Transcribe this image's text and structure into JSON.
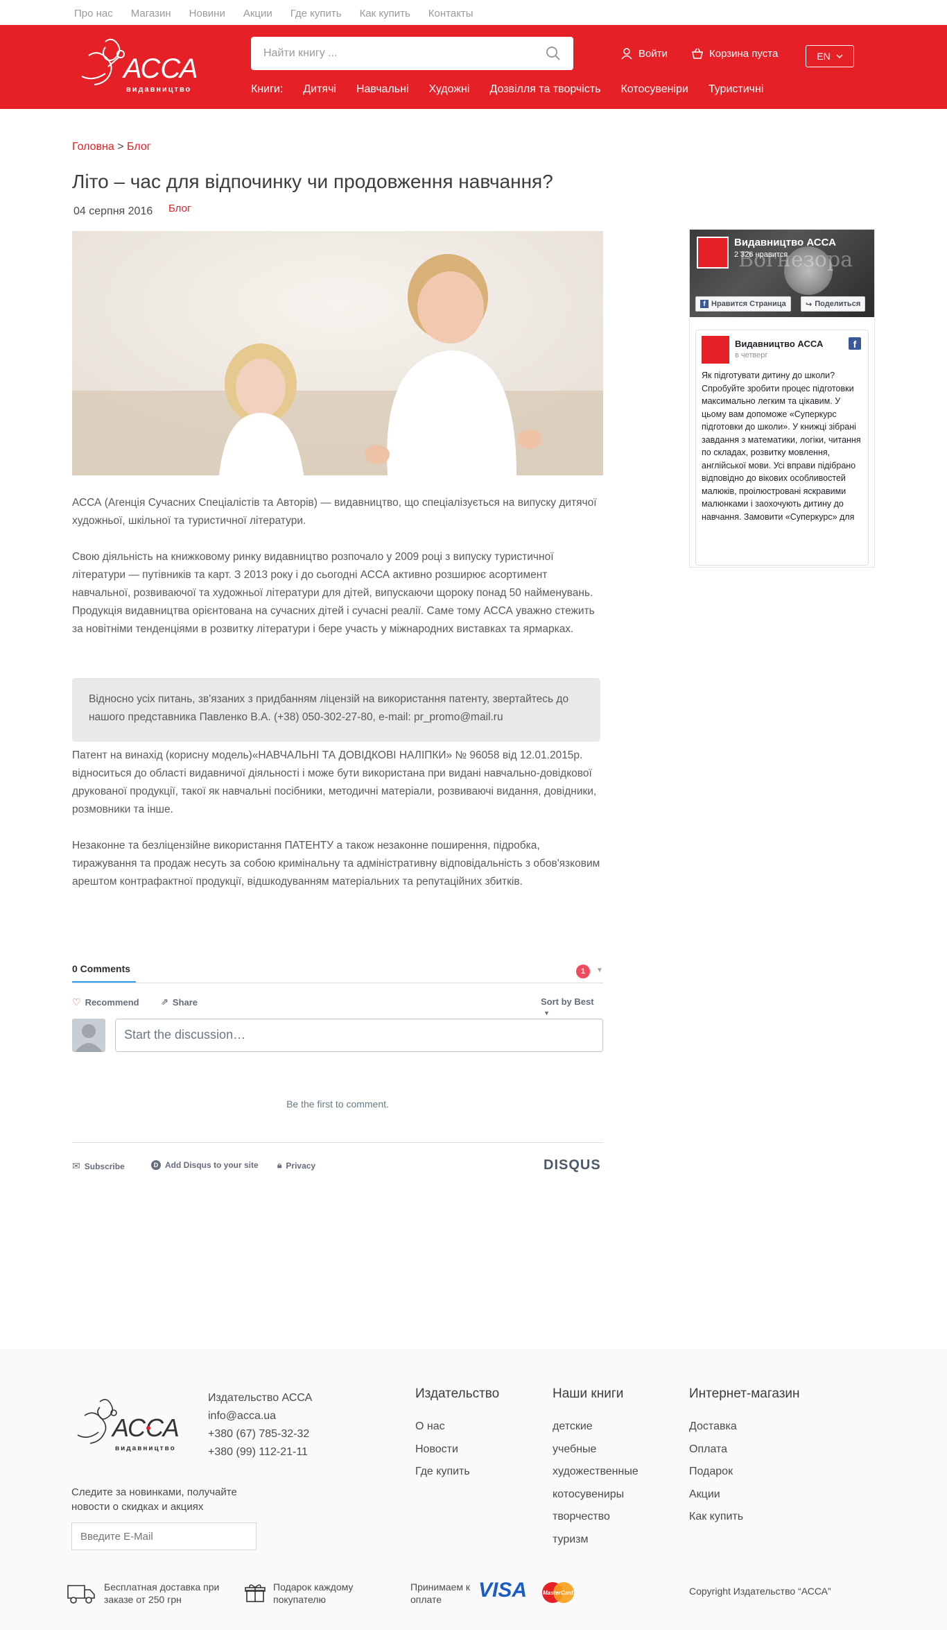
{
  "topnav": [
    "Про нас",
    "Магазин",
    "Новини",
    "Акции",
    "Где купить",
    "Как купить",
    "Контакты"
  ],
  "header": {
    "logo_text": "АССА",
    "logo_sub": "видавництво",
    "search_placeholder": "Найти книгу ...",
    "login": "Войти",
    "cart": "Корзина пуста",
    "lang": "EN"
  },
  "categories": [
    "Книги:",
    "Дитячі",
    "Навчальні",
    "Художні",
    "Дозвілля та творчість",
    "Котосувеніри",
    "Туристичні"
  ],
  "breadcrumb": {
    "home": "Головна",
    "sep": ">",
    "current": "Блог"
  },
  "article": {
    "title": "Літо – час для відпочинку чи продовження навчання?",
    "date": "04 серпня 2016",
    "category": "Блог",
    "p1": "АССА (Агенція Сучасних Спеціалістів та Авторів) — видавництво, що спеціалізується на випуску дитячої художньої, шкільної та туристичної літератури.",
    "p2": "Свою діяльність на книжковому ринку видавництво розпочало у 2009 році з випуску туристичної літератури — путівників та карт. З 2013 року і до сьогодні АССА активно розширює асортимент навчальної, розвиваючої та художньої літератури для дітей, випускаючи щороку понад 50 найменувань. Продукція видавництва орієнтована на сучасних дітей і сучасні реалії. Саме тому АССА уважно стежить за новітніми тенденціями в розвитку літератури і бере участь у міжнародних виставках та ярмарках.",
    "notice": "Відносно усіх питань, зв'язаних з придбанням ліцензій на використання патенту, звертайтесь до нашого представника Павленко В.А. (+38) 050-302-27-80, e-mail: pr_promo@mail.ru",
    "p3": "Патент на винахід (корисну модель)«НАВЧАЛЬНІ ТА ДОВІДКОВІ НАЛІПКИ» № 96058 від 12.01.2015р. відноситься до області видавничої діяльності і може бути використана при видані навчально-довідкової друкованої продукції, такої як навчальні посібники, методичні матеріали, розвиваючі видання, довідники, розмовники та інше.",
    "p4": "Незаконне та безліцензійне використання ПАТЕНТУ а також незаконне поширення, підробка, тиражування та продаж несуть за собою кримінальну та адміністративну відповідальність з обов'язковим арештом контрафактної продукції, відшкодуванням матеріальних та репутаційних збитків."
  },
  "disqus": {
    "count": "0 Comments",
    "badge": "1",
    "recommend": "Recommend",
    "share": "Share",
    "sort": "Sort by Best",
    "placeholder": "Start the discussion…",
    "empty": "Be the first to comment.",
    "subscribe": "Subscribe",
    "add": "Add Disqus to your site",
    "privacy": "Privacy",
    "brand": "DISQUS"
  },
  "facebook": {
    "page_name": "Видавництво АССА",
    "likes": "2 326 нравится",
    "cover_text": "Вогнезора",
    "like_btn": "Нравится Страница",
    "share_btn": "Поделиться",
    "post_name": "Видавництво АССА",
    "post_time": "в четверг",
    "post_text": "Як підготувати дитину до школи? Спробуйте зробити процес підготовки максимально легким та цікавим. У цьому вам допоможе «Суперкурс підготовки до школи». У книжці зібрані завдання з математики, логіки, читання по складах, розвитку мовлення, англійської мови. Усі вправи підібрано відповідно до вікових особливостей малюків, проілюстровані яскравими малюнками і заохочують дитину до навчання. Замовити «Суперкурс» для"
  },
  "footer": {
    "company": "Издательство АССА",
    "email": "info@acca.ua",
    "phone1": "+380 (67) 785-32-32",
    "phone2": "+380 (99) 112-21-11",
    "subscribe_text": "Следите за новинками, получайте новости о скидках и акциях",
    "email_placeholder": "Введите E-Mail",
    "col1": {
      "title": "Издательство",
      "items": [
        "О нас",
        "Новости",
        "Где купить"
      ]
    },
    "col2": {
      "title": "Наши книги",
      "items": [
        "детские",
        "учебные",
        "художественные",
        "котосувениры",
        "творчество",
        "туризм"
      ]
    },
    "col3": {
      "title": "Интернет-магазин",
      "items": [
        "Доставка",
        "Оплата",
        "Подарок",
        "Акции",
        "Как купить"
      ]
    },
    "delivery": "Бесплатная доставка при заказе от 250 грн",
    "gift": "Подарок каждому покупателю",
    "accept": "Принимаем к оплате",
    "visa": "VISA",
    "mastercard": "MasterCard",
    "copyright": "Copyright Издательство “АССА”"
  },
  "colors": {
    "brand_red": "#e52026",
    "notice_bg": "#e9e9e9"
  }
}
